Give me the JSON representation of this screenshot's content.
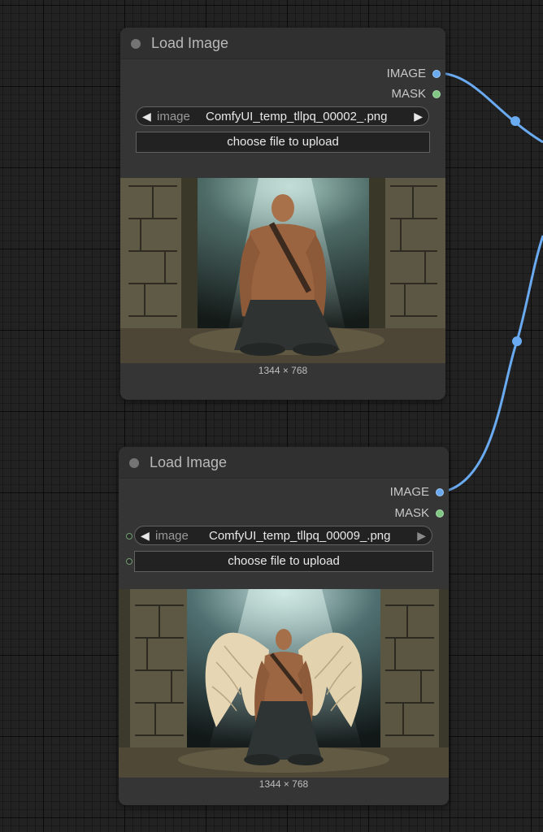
{
  "canvas": {
    "background": "#222222",
    "link_color": "#6aaaf0"
  },
  "nodes": [
    {
      "title": "Load Image",
      "outputs": [
        {
          "label": "IMAGE",
          "color": "#6aaaf0"
        },
        {
          "label": "MASK",
          "color": "#81c784"
        }
      ],
      "image_widget": {
        "name": "image",
        "value": "ComfyUI_temp_tllpq_00002_.png",
        "left_arrow": "◀",
        "right_arrow": "▶"
      },
      "upload_button": "choose file to upload",
      "preview_caption": "1344 × 768"
    },
    {
      "title": "Load Image",
      "outputs": [
        {
          "label": "IMAGE",
          "color": "#6aaaf0"
        },
        {
          "label": "MASK",
          "color": "#81c784"
        }
      ],
      "image_widget": {
        "name": "image",
        "value": "ComfyUI_temp_tllpq_00009_.png",
        "left_arrow": "◀",
        "right_arrow": "▶"
      },
      "upload_button": "choose file to upload",
      "preview_caption": "1344 × 768"
    }
  ]
}
